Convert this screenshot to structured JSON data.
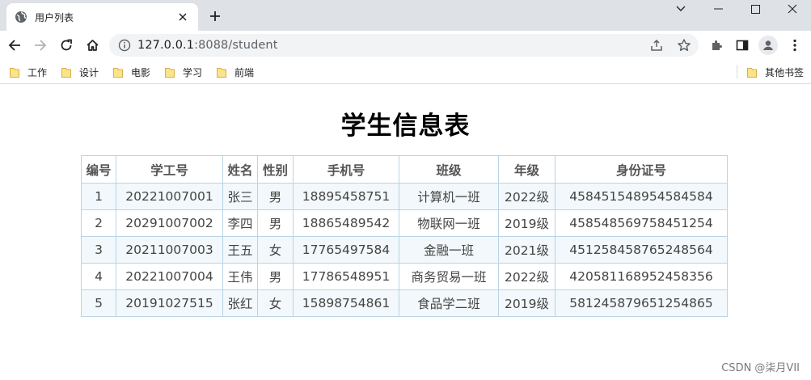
{
  "browser": {
    "tab": {
      "title": "用户列表",
      "icon": "globe-icon"
    },
    "address": {
      "host": "127.0.0.1",
      "port_path": ":8088/student"
    },
    "bookmarks": [
      {
        "label": "工作",
        "icon": "folder-icon"
      },
      {
        "label": "设计",
        "icon": "folder-icon"
      },
      {
        "label": "电影",
        "icon": "folder-icon"
      },
      {
        "label": "学习",
        "icon": "folder-icon"
      },
      {
        "label": "前端",
        "icon": "folder-icon"
      }
    ],
    "other_bookmarks": "其他书签"
  },
  "page": {
    "title": "学生信息表",
    "table": {
      "headers": [
        "编号",
        "学工号",
        "姓名",
        "性别",
        "手机号",
        "班级",
        "年级",
        "身份证号"
      ],
      "rows": [
        [
          "1",
          "20221007001",
          "张三",
          "男",
          "18895458751",
          "计算机一班",
          "2022级",
          "458451548954584584"
        ],
        [
          "2",
          "20291007002",
          "李四",
          "男",
          "18865489542",
          "物联网一班",
          "2019级",
          "458548569758451254"
        ],
        [
          "3",
          "20211007003",
          "王五",
          "女",
          "17765497584",
          "金融一班",
          "2021级",
          "451258458765248564"
        ],
        [
          "4",
          "20221007004",
          "王伟",
          "男",
          "17786548951",
          "商务贸易一班",
          "2022级",
          "420581168952458356"
        ],
        [
          "5",
          "20191027515",
          "张红",
          "女",
          "15898754861",
          "食品学二班",
          "2019级",
          "581245879651254865"
        ]
      ]
    }
  },
  "watermark": "CSDN @柒月VII",
  "colors": {
    "tabstrip": "#dee1e6",
    "table_border": "#b8d4e6",
    "row_stripe": "#f2f8fb"
  }
}
